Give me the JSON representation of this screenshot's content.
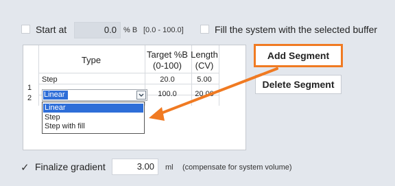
{
  "options": {
    "start_at": {
      "label": "Start at",
      "value": "0.0",
      "unit": "% B",
      "range": "[0.0 - 100.0]",
      "checked": false
    },
    "fill_system": {
      "label": "Fill the system with the selected buffer",
      "checked": false
    }
  },
  "table": {
    "headers": {
      "type": "Type",
      "target_line1": "Target %B",
      "target_line2": "(0-100)",
      "length_line1": "Length",
      "length_line2": "(CV)"
    },
    "rows": [
      {
        "num": "1",
        "type": "Step",
        "target": "20.0",
        "length": "5.00"
      },
      {
        "num": "2",
        "type": "Linear",
        "target": "100.0",
        "length": "20.00"
      }
    ],
    "dropdown_options": [
      "Linear",
      "Step",
      "Step with fill"
    ]
  },
  "buttons": {
    "add_segment": "Add Segment",
    "delete_segment": "Delete Segment"
  },
  "finalize": {
    "label": "Finalize gradient",
    "checked": true,
    "check_glyph": "✓",
    "value": "3.00",
    "unit": "ml",
    "note": "(compensate for system volume)"
  },
  "colors": {
    "highlight": "#f07a22",
    "selection": "#2e6ed8"
  },
  "icons": {
    "dropdown_arrow": "chevron-down-icon",
    "annotation": "arrow-icon"
  }
}
